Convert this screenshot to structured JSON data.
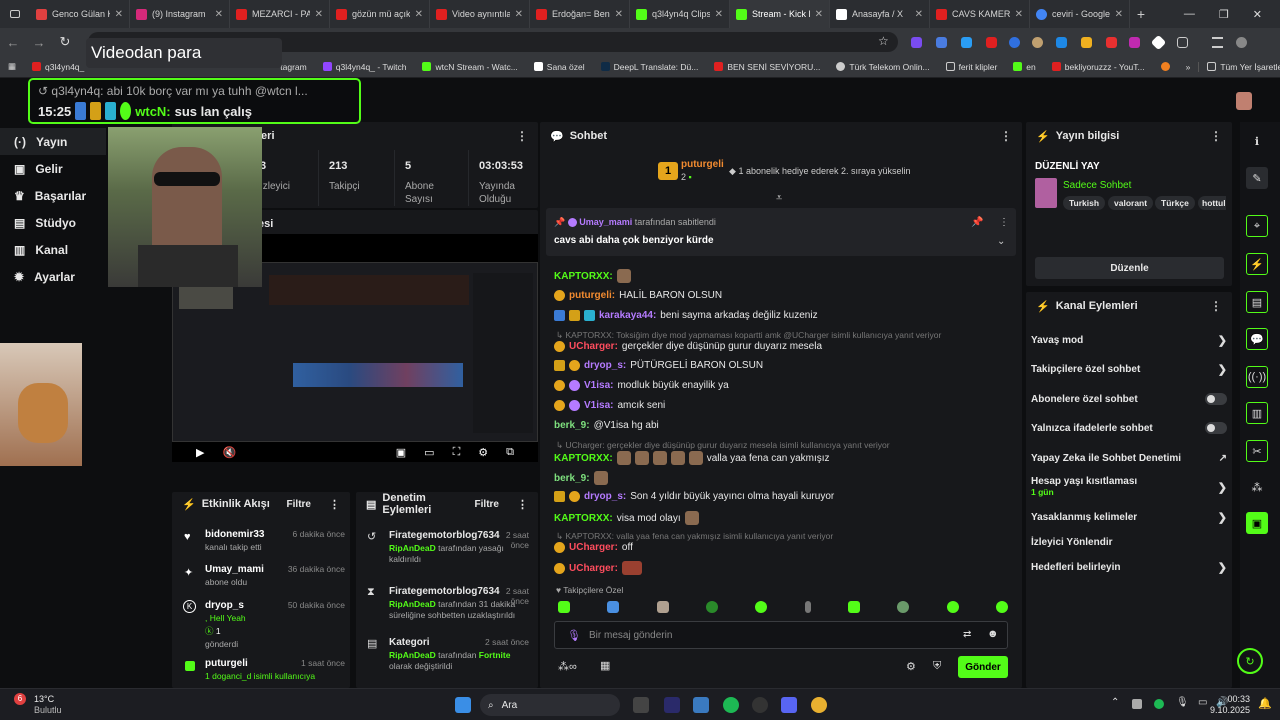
{
  "browser": {
    "tabs": [
      {
        "label": "Genco Gülan K",
        "color": "#e04040"
      },
      {
        "label": "(9) Instagram",
        "color": "#d6297a"
      },
      {
        "label": "MEZARCI - PA",
        "color": "#e02020"
      },
      {
        "label": "gözün mü açık",
        "color": "#e02020"
      },
      {
        "label": "Video aynıntılar",
        "color": "#e02020"
      },
      {
        "label": "Erdoğan= Ben",
        "color": "#e02020"
      },
      {
        "label": "q3l4yn4q Clips",
        "color": "#53fc18"
      },
      {
        "label": "Stream - Kick D",
        "color": "#53fc18"
      },
      {
        "label": "Anasayfa / X",
        "color": "#ffffff"
      },
      {
        "label": "CAVS KAMERA",
        "color": "#e02020"
      },
      {
        "label": "ceviri - Google",
        "color": "#4285f4"
      }
    ],
    "bookmarks": [
      "q3l4yn4q_",
      "tagram",
      "q3l4yn4q_ - Twitch",
      "wtcN Stream - Watc...",
      "Sana özel",
      "DeepL Translate: Dü...",
      "BEN SENİ SEVİYORU...",
      "Türk Telekom Onlin...",
      "ferit klipler",
      "en",
      "bekliyoruzzz - YouT..."
    ],
    "all_bookmarks": "Tüm Yer İşaretleri"
  },
  "overlay": {
    "video_tooltip": "Videodan para",
    "alert_reply": "q3l4yn4q: abi 10k borç var mı ya tuhh @wtcn l...",
    "alert_time": "15:25",
    "alert_user": "wtcN:",
    "alert_text": "sus lan çalış"
  },
  "nav": {
    "items": [
      "Yayın",
      "Gelir",
      "Başarılar",
      "Stüdyo",
      "Kanal",
      "Ayarlar"
    ],
    "icons": [
      "broadcast-icon",
      "revenue-icon",
      "trophy-icon",
      "studio-icon",
      "channel-icon",
      "settings-icon"
    ]
  },
  "stats": {
    "panel_title_suffix": "leri",
    "items": [
      {
        "value": "3",
        "label": "İzleyici"
      },
      {
        "value": "213",
        "label": "Takipçi"
      },
      {
        "value": "5",
        "label": "Abone Sayısı"
      },
      {
        "value": "03:03:53",
        "label": "Yayında Olduğu"
      }
    ],
    "preview_title_suffix": "esi"
  },
  "chat": {
    "title": "Sohbet",
    "gifter_name": "puturgeli",
    "gifter_count": "2",
    "gifter_rank": "1",
    "gift_prompt": "1 abonelik hediye ederek 2. sıraya yükselin",
    "pinned_by_user": "Umay_mami",
    "pinned_by_suffix": "tarafından sabitlendi",
    "pinned_text": "cavs abi daha çok benziyor kürde",
    "followers_only": "Takipçilere Özel",
    "input_placeholder": "Bir mesaj gönderin",
    "send_label": "Gönder",
    "messages": [
      {
        "user": "KAPTORXX:",
        "text": ""
      },
      {
        "user": "puturgeli:",
        "text": "HALİL BARON OLSUN"
      },
      {
        "user": "karakaya44:",
        "text": "beni sayma arkadaş değiliz kuzeniz"
      },
      {
        "reply": "KAPTORXX: Toksiğim diye mod yapmaması kopartti amk @UCharger isimli kullanıcıya yanıt veriyor"
      },
      {
        "user": "UCharger:",
        "text": "gerçekler diye düşünüp gurur duyarız mesela"
      },
      {
        "user": "dryop_s:",
        "text": "PÜTÜRGELİ BARON OLSUN"
      },
      {
        "user": "V1isa:",
        "text": "modluk büyük enayilik ya"
      },
      {
        "user": "V1isa:",
        "text": "amcık seni"
      },
      {
        "user": "berk_9:",
        "text": "@V1isa hg abi"
      },
      {
        "reply": "UCharger: gerçekler diye düşünüp gurur duyarız mesela isimli kullanıcıya yanıt veriyor"
      },
      {
        "user": "KAPTORXX:",
        "text": "valla yaa fena can yakmışız"
      },
      {
        "user": "berk_9:",
        "text": ""
      },
      {
        "user": "dryop_s:",
        "text": "Son 4 yıldır büyük yayıncı olma hayali kuruyor"
      },
      {
        "user": "KAPTORXX:",
        "text": "visa mod olayı"
      },
      {
        "reply": "KAPTORXX: valla yaa fena can yakmışız isimli kullanıcıya yanıt veriyor"
      },
      {
        "user": "UCharger:",
        "text": "off"
      },
      {
        "user": "UCharger:",
        "text": ""
      }
    ]
  },
  "activity": {
    "title": "Etkinlik Akışı",
    "filter": "Filtre",
    "items": [
      {
        "name": "bidonemir33",
        "time": "6 dakika önce",
        "sub": "kanalı takip etti"
      },
      {
        "name": "Umay_mami",
        "time": "36 dakika önce",
        "sub": "abone oldu"
      },
      {
        "name": "dryop_s",
        "time": "50 dakika önce",
        "sub": ", Hell Yeah",
        "extra": "1",
        "extra2": "gönderdi"
      },
      {
        "name": "puturgeli",
        "time": "1 saat önce",
        "sub": "1 doganci_d isimli kullanıcıya"
      }
    ]
  },
  "moderation": {
    "title": "Denetim Eylemleri",
    "filter": "Filtre",
    "items": [
      {
        "name": "Firategemotorblog7634",
        "time": "2 saat önce",
        "actor": "RipAnDeaD",
        "sub": "tarafından yasağı kaldırıldı"
      },
      {
        "name": "Firategemotorblog7634",
        "time": "2 saat önce",
        "actor": "RipAnDeaD",
        "sub": "tarafından 31 dakika süreliğine sohbetten uzaklaştırıldı"
      },
      {
        "name": "Kategori",
        "time": "2 saat önce",
        "actor": "RipAnDeaD",
        "sub": "tarafından",
        "category": "Fortnite",
        "sub2": "olarak değiştirildi"
      }
    ]
  },
  "stream_info": {
    "title": "Yayın bilgisi",
    "stream_title": "DÜZENLİ YAY",
    "category": "Sadece Sohbet",
    "tags": [
      "Turkish",
      "valorant",
      "Türkçe",
      "hottul"
    ],
    "edit": "Düzenle"
  },
  "channel_actions": {
    "title": "Kanal Eylemleri",
    "items": [
      {
        "label": "Yavaş mod",
        "type": "chevron"
      },
      {
        "label": "Takipçilere özel sohbet",
        "type": "chevron"
      },
      {
        "label": "Abonelere özel sohbet",
        "type": "toggle"
      },
      {
        "label": "Yalnızca ifadelerle sohbet",
        "type": "toggle"
      },
      {
        "label": "Yapay Zeka ile Sohbet Denetimi",
        "type": "external"
      },
      {
        "label": "Hesap yaşı kısıtlaması",
        "type": "chevron",
        "sub": "1 gün"
      },
      {
        "label": "Yasaklanmış kelimeler",
        "type": "chevron"
      },
      {
        "label": "İzleyici Yönlendir",
        "type": "none"
      },
      {
        "label": "Hedefleri belirleyin",
        "type": "chevron"
      }
    ]
  },
  "taskbar": {
    "weather_temp": "13°C",
    "weather_desc": "Bulutlu",
    "weather_badge": "6",
    "search": "Ara",
    "time": "00:33",
    "date": "9.10.2025"
  },
  "colors": {
    "accent": "#53fc18",
    "bg": "#0d0e10",
    "panel": "#17181b"
  }
}
